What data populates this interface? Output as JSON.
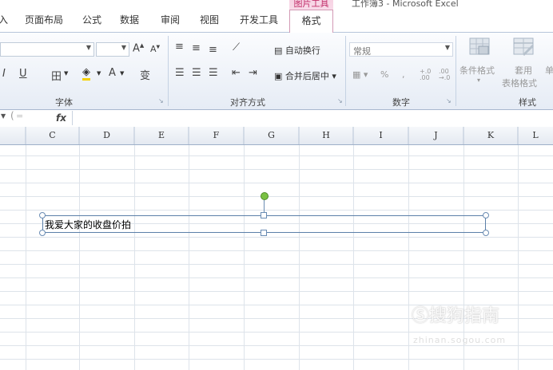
{
  "window": {
    "title": "工作簿3 - Microsoft Excel"
  },
  "tabs": [
    {
      "label": "入"
    },
    {
      "label": "页面布局"
    },
    {
      "label": "公式"
    },
    {
      "label": "数据"
    },
    {
      "label": "审阅"
    },
    {
      "label": "视图"
    },
    {
      "label": "开发工具"
    }
  ],
  "context_group": {
    "label": "图片工具",
    "tab": "格式"
  },
  "ribbon": {
    "font": {
      "label": "字体",
      "size_value": "",
      "grow": "A",
      "shrink": "A",
      "italic": "I",
      "underline": "U",
      "border": "田",
      "fill": "◈",
      "font_color": "A",
      "phonetic": "变"
    },
    "alignment": {
      "label": "对齐方式",
      "wrap_text": "自动换行",
      "merge_center": "合并后居中"
    },
    "number": {
      "label": "数字",
      "format_value": "常规",
      "percent": "%",
      "comma": ",",
      "inc_decimal": "+.0 .00",
      "dec_decimal": ".00 →.0"
    },
    "styles": {
      "label": "样式",
      "conditional": "条件格式",
      "table_line1": "套用",
      "table_line2": "表格格式",
      "cell_partial": "单"
    }
  },
  "formula_bar": {
    "fx": "fx",
    "value": ""
  },
  "columns": [
    "C",
    "D",
    "E",
    "F",
    "G",
    "H",
    "I",
    "J",
    "K",
    "L"
  ],
  "textbox": {
    "text": "我爱大家的收盘价拍"
  },
  "watermark": {
    "text": "搜狗指南",
    "sub": "zhinan.sogou.com"
  }
}
